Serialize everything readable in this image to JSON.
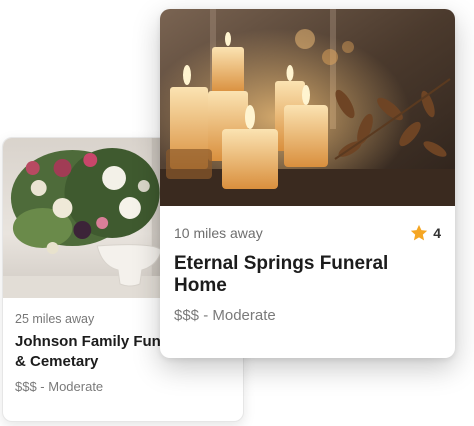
{
  "listings": [
    {
      "distance": "25 miles away",
      "name": "Johnson Family Funeral & Cemetary",
      "price": "$$$ - Moderate",
      "image_icon": "flower-arrangement-photo"
    },
    {
      "distance": "10 miles away",
      "name": "Eternal Springs Funeral Home",
      "price": "$$$ - Moderate",
      "rating": "4",
      "rating_icon": "star-icon",
      "image_icon": "candles-photo"
    }
  ],
  "colors": {
    "star": "#f5a623",
    "title": "#1c1c1c",
    "muted": "#7a7a7a"
  }
}
